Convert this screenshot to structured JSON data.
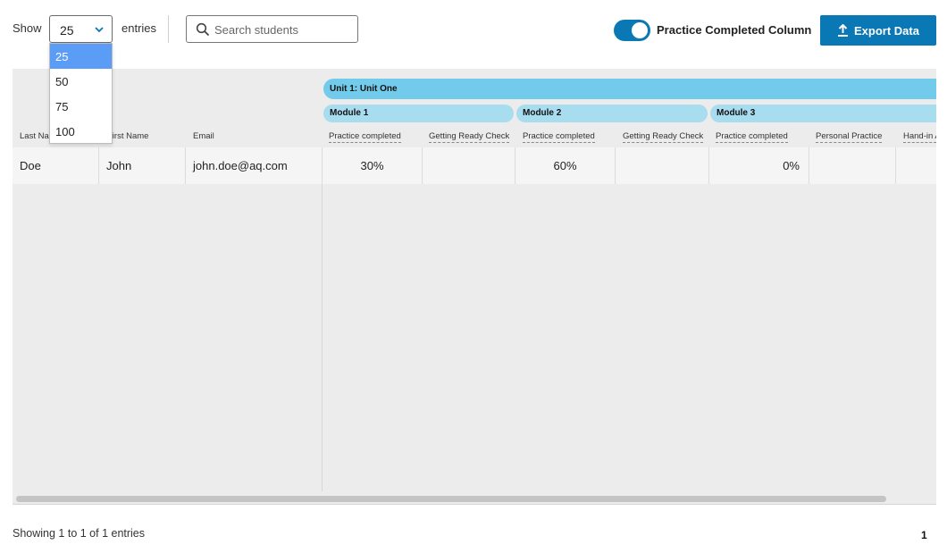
{
  "toolbar": {
    "show_label": "Show",
    "entries_value": "25",
    "entries_label": "entries",
    "search_placeholder": "Search students",
    "toggle_label": "Practice Completed Column",
    "toggle_on": true,
    "export_label": "Export Data"
  },
  "dropdown": {
    "open": true,
    "options": [
      "25",
      "50",
      "75",
      "100"
    ],
    "selected": "25"
  },
  "table": {
    "unit_label": "Unit 1: Unit One",
    "modules": [
      "Module 1",
      "Module 2",
      "Module 3"
    ],
    "frozen_headers": [
      "Last Name",
      "First Name",
      "Email"
    ],
    "column_headers": [
      "Practice completed",
      "Getting Ready Check",
      "Practice completed",
      "Getting Ready Check",
      "Practice completed",
      "Personal Practice",
      "Hand-in A"
    ],
    "rows": [
      {
        "last_name": "Doe",
        "first_name": "John",
        "email": "john.doe@aq.com",
        "values": [
          "30%",
          "",
          "60%",
          "",
          "0%",
          "",
          ""
        ]
      }
    ]
  },
  "footer": {
    "info": "Showing 1 to 1 of 1 entries",
    "page": "1"
  },
  "colors": {
    "accent": "#0a78b4",
    "unit_bar": "#72cbea",
    "module_bar": "#a8dcef",
    "dropdown_selected": "#5b9cf6"
  }
}
